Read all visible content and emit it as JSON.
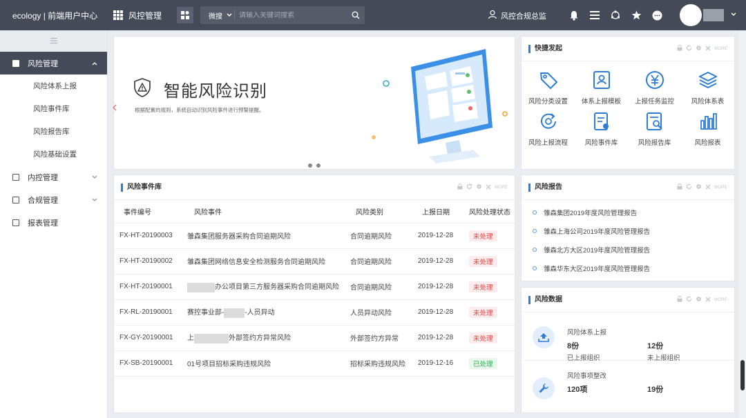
{
  "topbar": {
    "brand": "ecology | 前端用户中心",
    "module": "风控管理",
    "search_type": "微搜",
    "search_placeholder": "请输入关键词搜索",
    "role": "风控合规总监"
  },
  "sidebar": {
    "items": [
      {
        "label": "风险管理",
        "active": true,
        "children": [
          "风险体系上报",
          "风险事件库",
          "风险报告库",
          "风险基础设置"
        ]
      },
      {
        "label": "内控管理"
      },
      {
        "label": "合规管理"
      },
      {
        "label": "报表管理"
      }
    ]
  },
  "banner": {
    "title": "智能风险识别",
    "subtitle": "根据配置的规则，系统自动识别风险事件进行预警提醒。"
  },
  "events": {
    "title": "风险事件库",
    "more": "MORE",
    "columns": [
      "事件编号",
      "风险事件",
      "风险类别",
      "上报日期",
      "风险处理状态"
    ],
    "rows": [
      {
        "id": "FX-HT-20190003",
        "event": "雏森集团服务器采购合同逾期风险",
        "category": "合同逾期风险",
        "date": "2019-12-28",
        "status": "未处理",
        "ok": false
      },
      {
        "id": "FX-HT-20190002",
        "event": "雏森集团网络信息安全检测服务合同逾期风险",
        "category": "合同逾期风险",
        "date": "2019-12-28",
        "status": "未处理",
        "ok": false
      },
      {
        "id": "FX-HT-20190001",
        "event_pre": "",
        "event": "办公项目第三方服务器采购合同逾期风险",
        "category": "合同逾期风险",
        "date": "2019-12-28",
        "status": "未处理",
        "ok": false
      },
      {
        "id": "FX-RL-20190001",
        "event_pre": "赛控事业部-",
        "event": "-人员异动",
        "category": "人员异动风险",
        "date": "2019-12-28",
        "status": "未处理",
        "ok": false
      },
      {
        "id": "FX-GY-20190001",
        "event_pre": "上",
        "event": "外部签约方异常风险",
        "category": "外部签约方异常",
        "date": "2019-12-28",
        "status": "未处理",
        "ok": false
      },
      {
        "id": "FX-SB-20190001",
        "event": "01号项目招标采购违规风险",
        "category": "招标采购违规风险",
        "date": "2019-12-16",
        "status": "已处理",
        "ok": true
      }
    ]
  },
  "quick": {
    "title": "快捷发起",
    "more": "MORE",
    "items": [
      {
        "label": "风险分类设置",
        "icon": "tag-icon"
      },
      {
        "label": "体系上报模板",
        "icon": "user-card-icon"
      },
      {
        "label": "上报任务监控",
        "icon": "yen-icon"
      },
      {
        "label": "风险体系表",
        "icon": "layers-icon"
      },
      {
        "label": "风险上报流程",
        "icon": "refresh-icon"
      },
      {
        "label": "风险事件库",
        "icon": "document-icon"
      },
      {
        "label": "风险报告库",
        "icon": "report-search-icon"
      },
      {
        "label": "风险报表",
        "icon": "bar-chart-icon"
      }
    ]
  },
  "reports": {
    "title": "风险报告",
    "more": "MORE",
    "items": [
      "雏森集团2019年度风险管理报告",
      "雏森上海公司2019年度风险管理报告",
      "雏森北方大区2019年度风险管理报告",
      "雏森华东大区2019年度风险管理报告"
    ]
  },
  "risk_data": {
    "title": "风险数据",
    "more": "MORE",
    "blocks": [
      {
        "title": "风险体系上报",
        "v1": "8份",
        "l1": "已上报组织",
        "v2": "12份",
        "l2": "未上报组织"
      },
      {
        "title": "风险事项整改",
        "v1": "120项",
        "v2": "19份"
      }
    ]
  },
  "colors": {
    "topbar": "#444a57",
    "accent": "#2f7cd7",
    "danger": "#e04a4a",
    "success": "#3aaa56"
  }
}
